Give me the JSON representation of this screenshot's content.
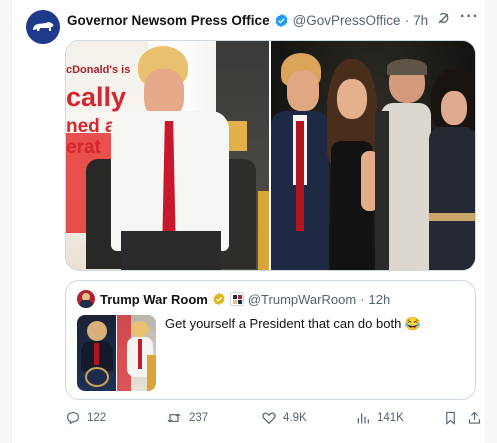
{
  "tweet": {
    "author_name": "Governor Newsom Press Office",
    "handle": "@GovPressOffice",
    "separator": "·",
    "time": "7h",
    "icons": {
      "avatar": "bear-flag-icon",
      "verified": "verified-badge-icon",
      "grok": "grok-icon",
      "more": "more-icon"
    },
    "more_label": "···",
    "media": {
      "image1_sign_lines": [
        "cDonald's is",
        "cally",
        "ned a",
        "erat"
      ],
      "image1_alt": "",
      "image2_alt": ""
    }
  },
  "quoted_tweet": {
    "author_name": "Trump War Room",
    "handle": "@TrumpWarRoom",
    "separator": "·",
    "time": "12h",
    "text": "Get yourself a President that can do both 😂",
    "icons": {
      "verified": "gold-verified-badge-icon",
      "affiliate": "affiliate-badge-icon"
    }
  },
  "actions": {
    "replies": "122",
    "reposts": "237",
    "likes": "4.9K",
    "views": "141K",
    "icons": [
      "reply-icon",
      "repost-icon",
      "like-icon",
      "views-icon",
      "bookmark-icon",
      "share-icon"
    ]
  },
  "colors": {
    "text_primary": "#0f1419",
    "text_secondary": "#536471",
    "border": "#cfd9de",
    "verified_blue": "#1d9bf0",
    "verified_gold": "#e2b719",
    "sign_red": "#d6252e"
  }
}
